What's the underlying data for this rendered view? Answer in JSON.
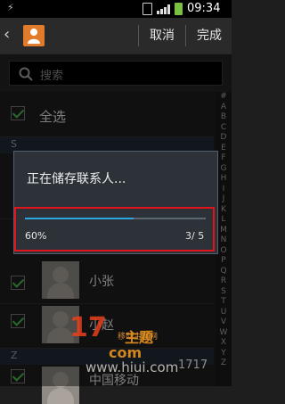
{
  "status_bar": {
    "time": "09:34",
    "usb_icon": "usb-icon",
    "sim_icon": "sim-card-icon",
    "signal_icon": "signal-icon",
    "battery_icon": "battery-charging-icon"
  },
  "action_bar": {
    "cancel_label": "取消",
    "done_label": "完成",
    "back_icon": "back-arrow-icon",
    "contact_icon": "contact-avatar-icon"
  },
  "search": {
    "placeholder": "搜索"
  },
  "select_all": {
    "label": "全选",
    "checked": true
  },
  "sections": [
    "S",
    "Z"
  ],
  "index_letters": [
    "#",
    "A",
    "B",
    "C",
    "D",
    "E",
    "F",
    "G",
    "H",
    "I",
    "J",
    "K",
    "L",
    "M",
    "N",
    "O",
    "P",
    "Q",
    "R",
    "S",
    "T",
    "U",
    "V",
    "W",
    "X",
    "Y",
    "Z"
  ],
  "contacts": [
    {
      "name": "小张",
      "checked": true
    },
    {
      "name": "小赵",
      "checked": true
    },
    {
      "name": "中国移动",
      "checked": true
    }
  ],
  "dialog": {
    "title": "正在储存联系人...",
    "progress_percent_label": "60%",
    "progress_count_label": "3/ 5",
    "progress_fraction": 0.6
  },
  "watermark": {
    "big": "17",
    "sub": "主题",
    "tag": "移动主题网",
    "domain": "com",
    "url": "www.hiui.com",
    "tail": "1717"
  },
  "colors": {
    "accent": "#2ba6de",
    "check": "#4cc04f",
    "highlight": "#e0141a",
    "avatar": "#e17b2c"
  }
}
